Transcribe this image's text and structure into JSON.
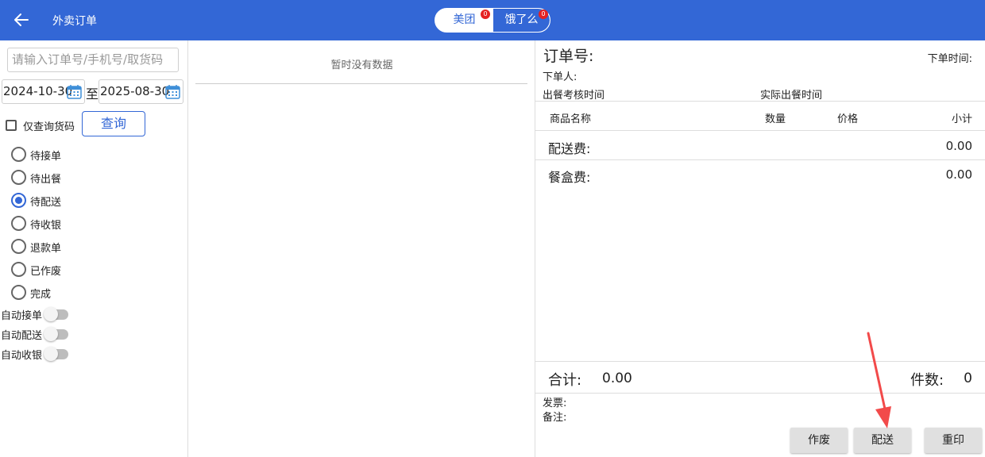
{
  "header": {
    "title": "外卖订单",
    "tabs": [
      {
        "label": "美团",
        "badge": "0"
      },
      {
        "label": "饿了么",
        "badge": "0"
      }
    ]
  },
  "filters": {
    "search_placeholder": "请输入订单号/手机号/取货码",
    "date_from": "2024-10-30",
    "date_sep": "至",
    "date_to": "2025-08-30",
    "pickup_only_label": "仅查询货码",
    "query_label": "查询",
    "statuses": [
      "待接单",
      "待出餐",
      "待配送",
      "待收银",
      "退款单",
      "已作废",
      "完成"
    ],
    "selected_status": "待配送",
    "toggles": [
      "自动接单",
      "自动配送",
      "自动收银"
    ]
  },
  "list": {
    "empty_text": "暂时没有数据"
  },
  "detail": {
    "order_no_label": "订单号:",
    "order_time_label": "下单时间:",
    "orderer_label": "下单人:",
    "meal_check_label": "出餐考核时间",
    "meal_actual_label": "实际出餐时间",
    "columns": {
      "name": "商品名称",
      "qty": "数量",
      "price": "价格",
      "subtotal": "小计"
    },
    "delivery_fee_label": "配送费:",
    "delivery_fee_value": "0.00",
    "box_fee_label": "餐盒费:",
    "box_fee_value": "0.00",
    "total_label": "合计:",
    "total_value": "0.00",
    "count_label": "件数:",
    "count_value": "0",
    "invoice_label": "发票:",
    "remark_label": "备注:"
  },
  "actions": {
    "void_label": "作废",
    "deliver_label": "配送",
    "reprint_label": "重印"
  },
  "colors": {
    "primary": "#3367d6",
    "badge": "#e52222",
    "arrow": "#f24a4a"
  }
}
